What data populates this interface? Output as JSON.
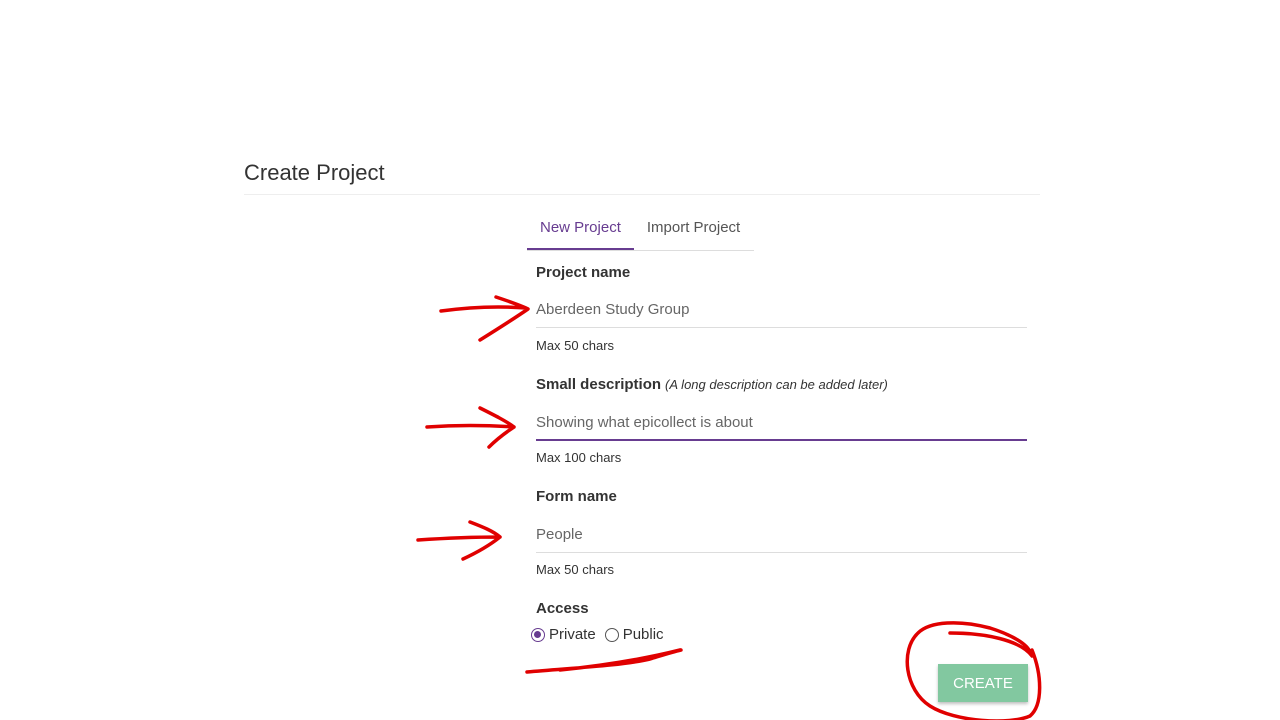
{
  "page": {
    "title": "Create Project"
  },
  "tabs": [
    {
      "label": "New Project",
      "active": true
    },
    {
      "label": "Import Project",
      "active": false
    }
  ],
  "form": {
    "project_name": {
      "label": "Project name",
      "value": "Aberdeen Study Group",
      "help": "Max 50 chars"
    },
    "small_description": {
      "label": "Small description",
      "hint": "(A long description can be added later)",
      "value": "Showing what epicollect is about",
      "help": "Max 100 chars"
    },
    "form_name": {
      "label": "Form name",
      "value": "People",
      "help": "Max 50 chars"
    },
    "access": {
      "label": "Access",
      "options": [
        {
          "label": "Private",
          "checked": true
        },
        {
          "label": "Public",
          "checked": false
        }
      ]
    },
    "create_label": "CREATE"
  },
  "colors": {
    "accent": "#673c90",
    "create_button": "#82c8a0",
    "annotation": "#e00000"
  }
}
